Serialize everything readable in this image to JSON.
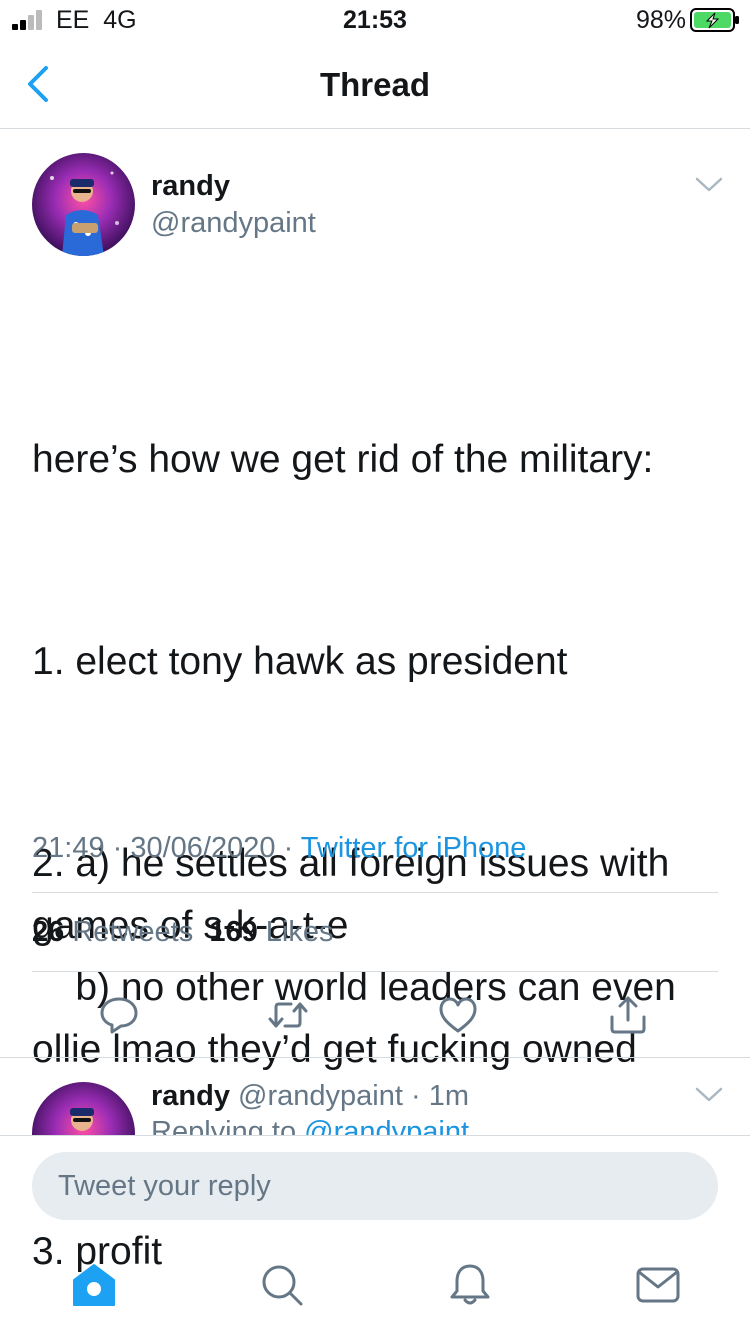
{
  "status_bar": {
    "carrier": "EE",
    "network": "4G",
    "time": "21:53",
    "battery_percent": "98%"
  },
  "nav": {
    "title": "Thread",
    "back_icon": "chevron-left-icon"
  },
  "tweet": {
    "author_name": "randy",
    "author_handle": "@randypaint",
    "lines": [
      "here’s how we get rid of the military:",
      "1. elect tony hawk as president",
      "2. a) he settles all foreign issues with games of s-k-a-t-e\n    b) no other world leaders can even ollie lmao they’d get fucking owned",
      "3. profit"
    ],
    "time": "21:49",
    "date": "30/06/2020",
    "source": "Twitter for iPhone",
    "retweet_count": "26",
    "retweet_label": "Retweets",
    "like_count": "169",
    "like_label": "Likes"
  },
  "actions": [
    "reply-icon",
    "retweet-icon",
    "like-icon",
    "share-icon"
  ],
  "reply_preview": {
    "author_name": "randy",
    "author_handle": "@randypaint",
    "age": "1m",
    "replying_prefix": "Replying to",
    "replying_to": "@randypaint"
  },
  "composer": {
    "placeholder": "Tweet your reply"
  },
  "tab_bar": [
    "home-icon",
    "search-icon",
    "notifications-icon",
    "messages-icon"
  ],
  "colors": {
    "accent": "#1da1f2",
    "link": "#1b95e0",
    "secondary_text": "#657786",
    "battery_fill": "#4cd964"
  }
}
